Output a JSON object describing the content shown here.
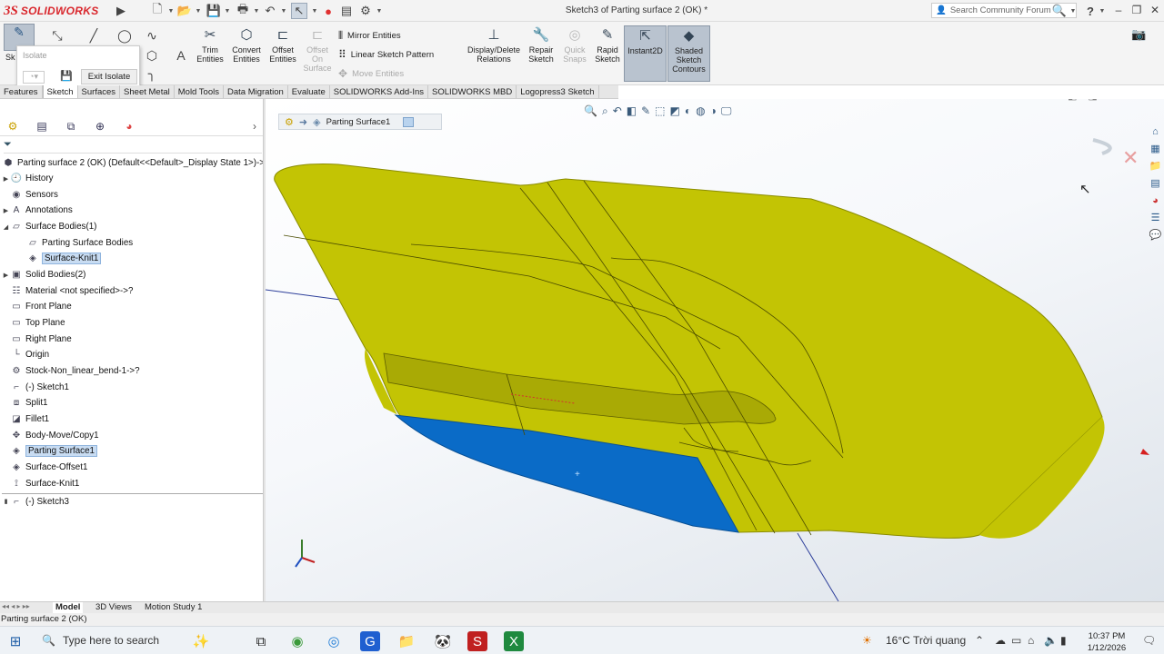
{
  "app": {
    "logo_mark": "3S",
    "logo_text": "SOLIDWORKS",
    "document_title": "Sketch3 of Parting surface 2 (OK) *",
    "search_placeholder": "Search Community Forum",
    "help_label": "?",
    "accent_color": "#d9262c"
  },
  "ribbon": {
    "isolate_title": "Isolate",
    "exit_isolate_label": "Exit Isolate",
    "sketch_short": "Sk",
    "buttons": {
      "trim": "Trim Entities",
      "convert": "Convert Entities",
      "offset": "Offset Entities",
      "offset_surface": "Offset On Surface",
      "mirror": "Mirror Entities",
      "linear_pattern": "Linear Sketch Pattern",
      "move": "Move Entities",
      "display_delete": "Display/Delete Relations",
      "repair": "Repair Sketch",
      "quick_snaps": "Quick Snaps",
      "rapid": "Rapid Sketch",
      "instant2d": "Instant2D",
      "shaded": "Shaded Sketch Contours"
    }
  },
  "tabs": [
    "Features",
    "Sketch",
    "Surfaces",
    "Sheet Metal",
    "Mold Tools",
    "Data Migration",
    "Evaluate",
    "SOLIDWORKS Add-Ins",
    "SOLIDWORKS MBD",
    "Logopress3 Sketch"
  ],
  "breadcrumb": {
    "label": "Parting Surface1"
  },
  "tree": {
    "root": "Parting surface 2 (OK)  (Default<<Default>_Display State 1>)->?",
    "items": [
      {
        "label": "History",
        "icon": "history-icon"
      },
      {
        "label": "Sensors",
        "icon": "sensor-icon"
      },
      {
        "label": "Annotations",
        "icon": "annotation-icon"
      },
      {
        "label": "Surface Bodies(1)",
        "icon": "surface-folder-icon"
      },
      {
        "label": "Parting Surface Bodies",
        "icon": "folder-icon"
      },
      {
        "label": "Surface-Knit1",
        "icon": "surface-icon"
      },
      {
        "label": "Solid Bodies(2)",
        "icon": "solid-folder-icon"
      },
      {
        "label": "Material <not specified>->?",
        "icon": "material-icon"
      },
      {
        "label": "Front Plane",
        "icon": "plane-icon"
      },
      {
        "label": "Top Plane",
        "icon": "plane-icon"
      },
      {
        "label": "Right Plane",
        "icon": "plane-icon"
      },
      {
        "label": "Origin",
        "icon": "origin-icon"
      },
      {
        "label": "Stock-Non_linear_bend-1->?",
        "icon": "feature-icon"
      },
      {
        "label": "(-) Sketch1",
        "icon": "sketch-icon"
      },
      {
        "label": "Split1",
        "icon": "split-icon"
      },
      {
        "label": "Fillet1",
        "icon": "fillet-icon"
      },
      {
        "label": "Body-Move/Copy1",
        "icon": "move-icon"
      },
      {
        "label": "Parting Surface1",
        "icon": "parting-surface-icon"
      },
      {
        "label": "Surface-Offset1",
        "icon": "offset-icon"
      },
      {
        "label": "Surface-Knit1",
        "icon": "knit-icon"
      },
      {
        "label": "(-) Sketch3",
        "icon": "sketch-icon"
      }
    ]
  },
  "bottom_tabs": [
    "Model",
    "3D Views",
    "Motion Study 1"
  ],
  "status": "Parting surface 2 (OK)",
  "taskbar": {
    "search_placeholder": "Type here to search",
    "temperature": "16°C",
    "weather": "Trời quang",
    "time": "10:37 PM",
    "date": "1/12/2026"
  },
  "colors": {
    "surface_yellow": "#c3c404",
    "surface_blue": "#0a6bc7",
    "viewport_top": "#ffffff"
  }
}
